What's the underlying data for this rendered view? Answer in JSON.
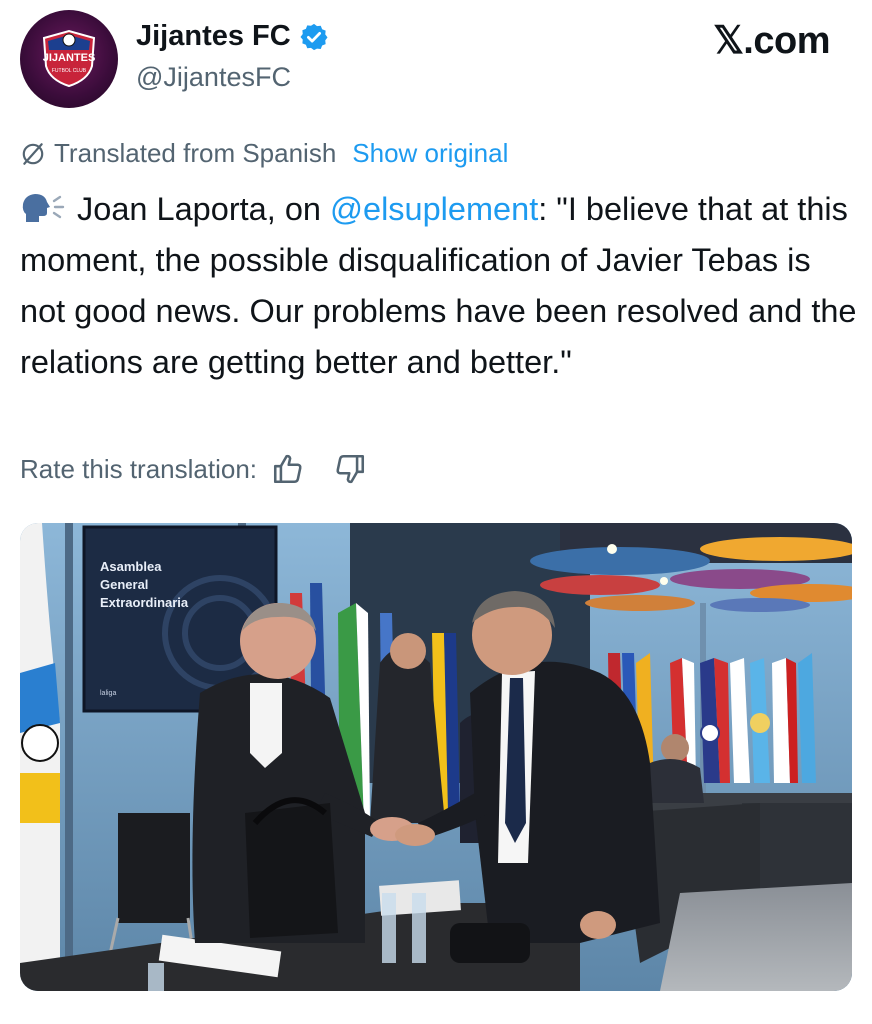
{
  "author": {
    "display_name": "Jijantes FC",
    "handle": "@JijantesFC",
    "avatar_text": "JIJANTES",
    "avatar_subtext": "FUTBOL CLUB"
  },
  "brand": "𝕏.com",
  "translation": {
    "label": "Translated from Spanish",
    "show_original": "Show original"
  },
  "tweet": {
    "speaking_icon": "speaking-head-icon",
    "part1": " Joan Laporta, on ",
    "mention": "@elsuplement",
    "part2": ": \"I believe that at this moment, the possible disqualification of Javier Tebas is not good news. Our problems have been resolved and the relations are getting better and better.\""
  },
  "rate": {
    "label": "Rate this translation:"
  },
  "photo": {
    "screen_line1": "Asamblea",
    "screen_line2": "General",
    "screen_line3": "Extraordinaria",
    "screen_logo": "laliga"
  },
  "colors": {
    "link": "#1d9bf0",
    "secondary_text": "#536471",
    "primary_text": "#0f1419"
  }
}
